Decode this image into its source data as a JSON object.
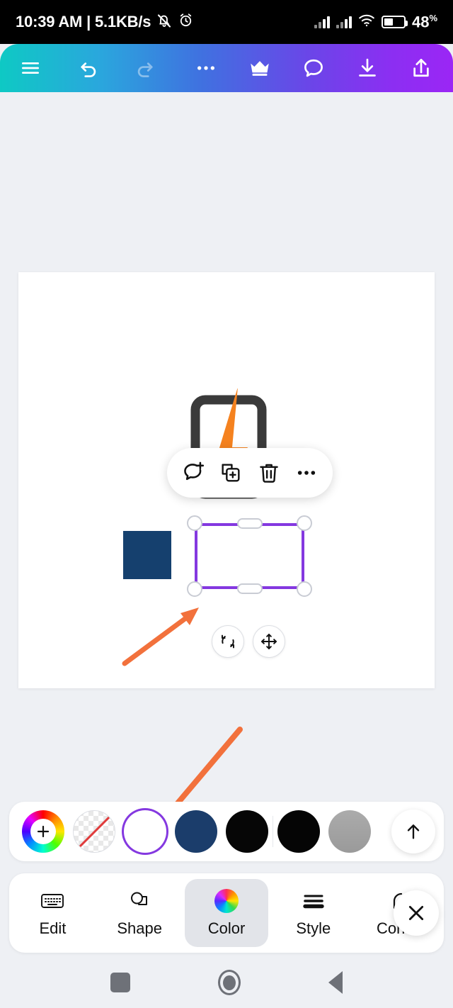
{
  "statusbar": {
    "time_and_speed": "10:39 AM | 5.1KB/s",
    "mute_icon": "bell-muted-icon",
    "alarm_icon": "alarm-clock-icon",
    "signal_icon_1": "signal-bars-icon",
    "signal_icon_2": "signal-bars-icon",
    "wifi_icon": "wifi-icon",
    "battery_icon": "battery-icon",
    "battery_percent": "48",
    "percent_symbol": "%"
  },
  "toolbar": {
    "menu_icon": "hamburger-menu-icon",
    "undo_icon": "undo-icon",
    "redo_icon": "redo-icon",
    "more_icon": "more-horizontal-icon",
    "crown_icon": "crown-icon",
    "comment_icon": "comment-bubble-icon",
    "download_icon": "download-icon",
    "share_icon": "share-icon",
    "gradient_start": "#0ec9c4",
    "gradient_end": "#9b26f5"
  },
  "canvas": {
    "background": "#ffffff",
    "logo_icon": "app-logo-phone-lightning-icon",
    "logo_bolt_color": "#f5821f",
    "logo_body_color": "#3a3a3a",
    "navy_square_color": "#15406e",
    "selection_border_color": "#8438e0"
  },
  "context_toolbar": {
    "add_comment_icon": "add-comment-icon",
    "duplicate_icon": "duplicate-icon",
    "delete_icon": "trash-icon",
    "more_icon": "more-horizontal-icon"
  },
  "object_controls": {
    "rotate_icon": "rotate-icon",
    "move_icon": "move-arrows-icon"
  },
  "annotations": {
    "arrow_color": "#f2713c",
    "arrow_1": "arrow-pointing-to-selection",
    "arrow_2": "arrow-pointing-to-white-swatch"
  },
  "palette": {
    "add_color_icon": "color-wheel-plus-icon",
    "add_color_label": "+",
    "swatches": [
      {
        "name": "color-picker",
        "type": "wheel",
        "color": ""
      },
      {
        "name": "transparent",
        "type": "none",
        "color": "transparent"
      },
      {
        "name": "white",
        "type": "solid",
        "color": "#ffffff",
        "selected": true
      },
      {
        "name": "navy",
        "type": "solid",
        "color": "#1b3d6b",
        "selected": false
      },
      {
        "name": "black",
        "type": "solid",
        "color": "#060606",
        "selected": false
      },
      {
        "name": "black-2",
        "type": "solid",
        "color": "#050505",
        "selected": false
      },
      {
        "name": "gray",
        "type": "solid",
        "color": "#a3a3a3",
        "selected": false
      }
    ],
    "expand_icon": "arrow-up-icon"
  },
  "tabbar": {
    "tabs": [
      {
        "label": "Edit",
        "icon": "keyboard-icon",
        "active": false
      },
      {
        "label": "Shape",
        "icon": "shape-icon",
        "active": false
      },
      {
        "label": "Color",
        "icon": "color-wheel-icon",
        "active": true
      },
      {
        "label": "Style",
        "icon": "style-lines-icon",
        "active": false
      },
      {
        "label": "Corner",
        "icon": "corner-arc-icon",
        "active": false
      }
    ],
    "close_icon": "close-x-icon"
  },
  "navbar": {
    "recents_icon": "recents-square-icon",
    "home_icon": "home-circle-icon",
    "back_icon": "back-triangle-icon"
  }
}
